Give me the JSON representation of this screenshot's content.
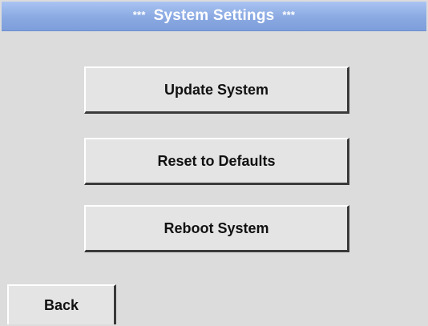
{
  "window": {
    "title": "System Settings",
    "title_decoration_left": "***",
    "title_decoration_right": "***"
  },
  "buttons": {
    "update_system": "Update System",
    "reset_defaults": "Reset to Defaults",
    "reboot_system": "Reboot System",
    "back": "Back"
  },
  "colors": {
    "title_bar": "#8aa9e2",
    "background": "#dcdcdc",
    "button_face": "#e4e4e4",
    "title_text": "#ffffff"
  }
}
